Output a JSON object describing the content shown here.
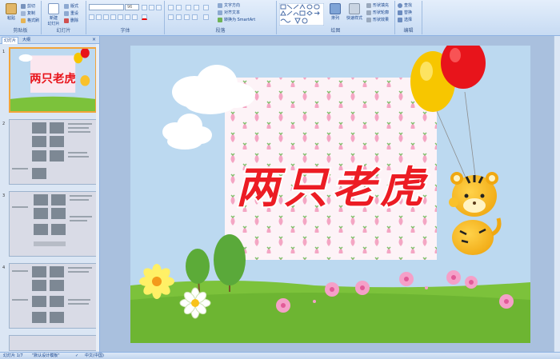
{
  "ribbon": {
    "clipboard": {
      "paste": "粘贴",
      "cut": "剪切",
      "copy": "复制",
      "format_painter": "格式刷",
      "label": "剪贴板"
    },
    "slides": {
      "new_slide": "新建",
      "new_slide_2": "幻灯片",
      "layout": "版式",
      "reset": "重设",
      "delete": "删除",
      "label": "幻灯片"
    },
    "font": {
      "font_size": "96",
      "label": "字体"
    },
    "paragraph": {
      "text_direction": "文字方向",
      "align_text": "对齐文本",
      "smartart": "转换为 SmartArt",
      "label": "段落"
    },
    "drawing": {
      "arrange": "排列",
      "quick_styles": "快速样式",
      "shape_fill": "形状填充",
      "shape_outline": "形状轮廓",
      "shape_effects": "形状效果",
      "label": "绘图"
    },
    "editing": {
      "find": "查找",
      "replace": "替换",
      "select": "选择",
      "label": "编辑"
    }
  },
  "panel": {
    "tab_slides": "幻灯片",
    "tab_outline": "大纲",
    "slide_numbers": [
      "1",
      "2",
      "3",
      "4"
    ]
  },
  "slide": {
    "title": "两只老虎"
  },
  "status": {
    "slide_info": "幻灯片 1/7",
    "theme": "\"默认设计模板\"",
    "language": "中文(中国)"
  },
  "colors": {
    "ribbon_bg": "#dbe7f6",
    "title_red": "#ec1c24",
    "balloon_red": "#e8141b",
    "balloon_yellow": "#f7c600",
    "selected_thumb": "#f2a43a"
  }
}
